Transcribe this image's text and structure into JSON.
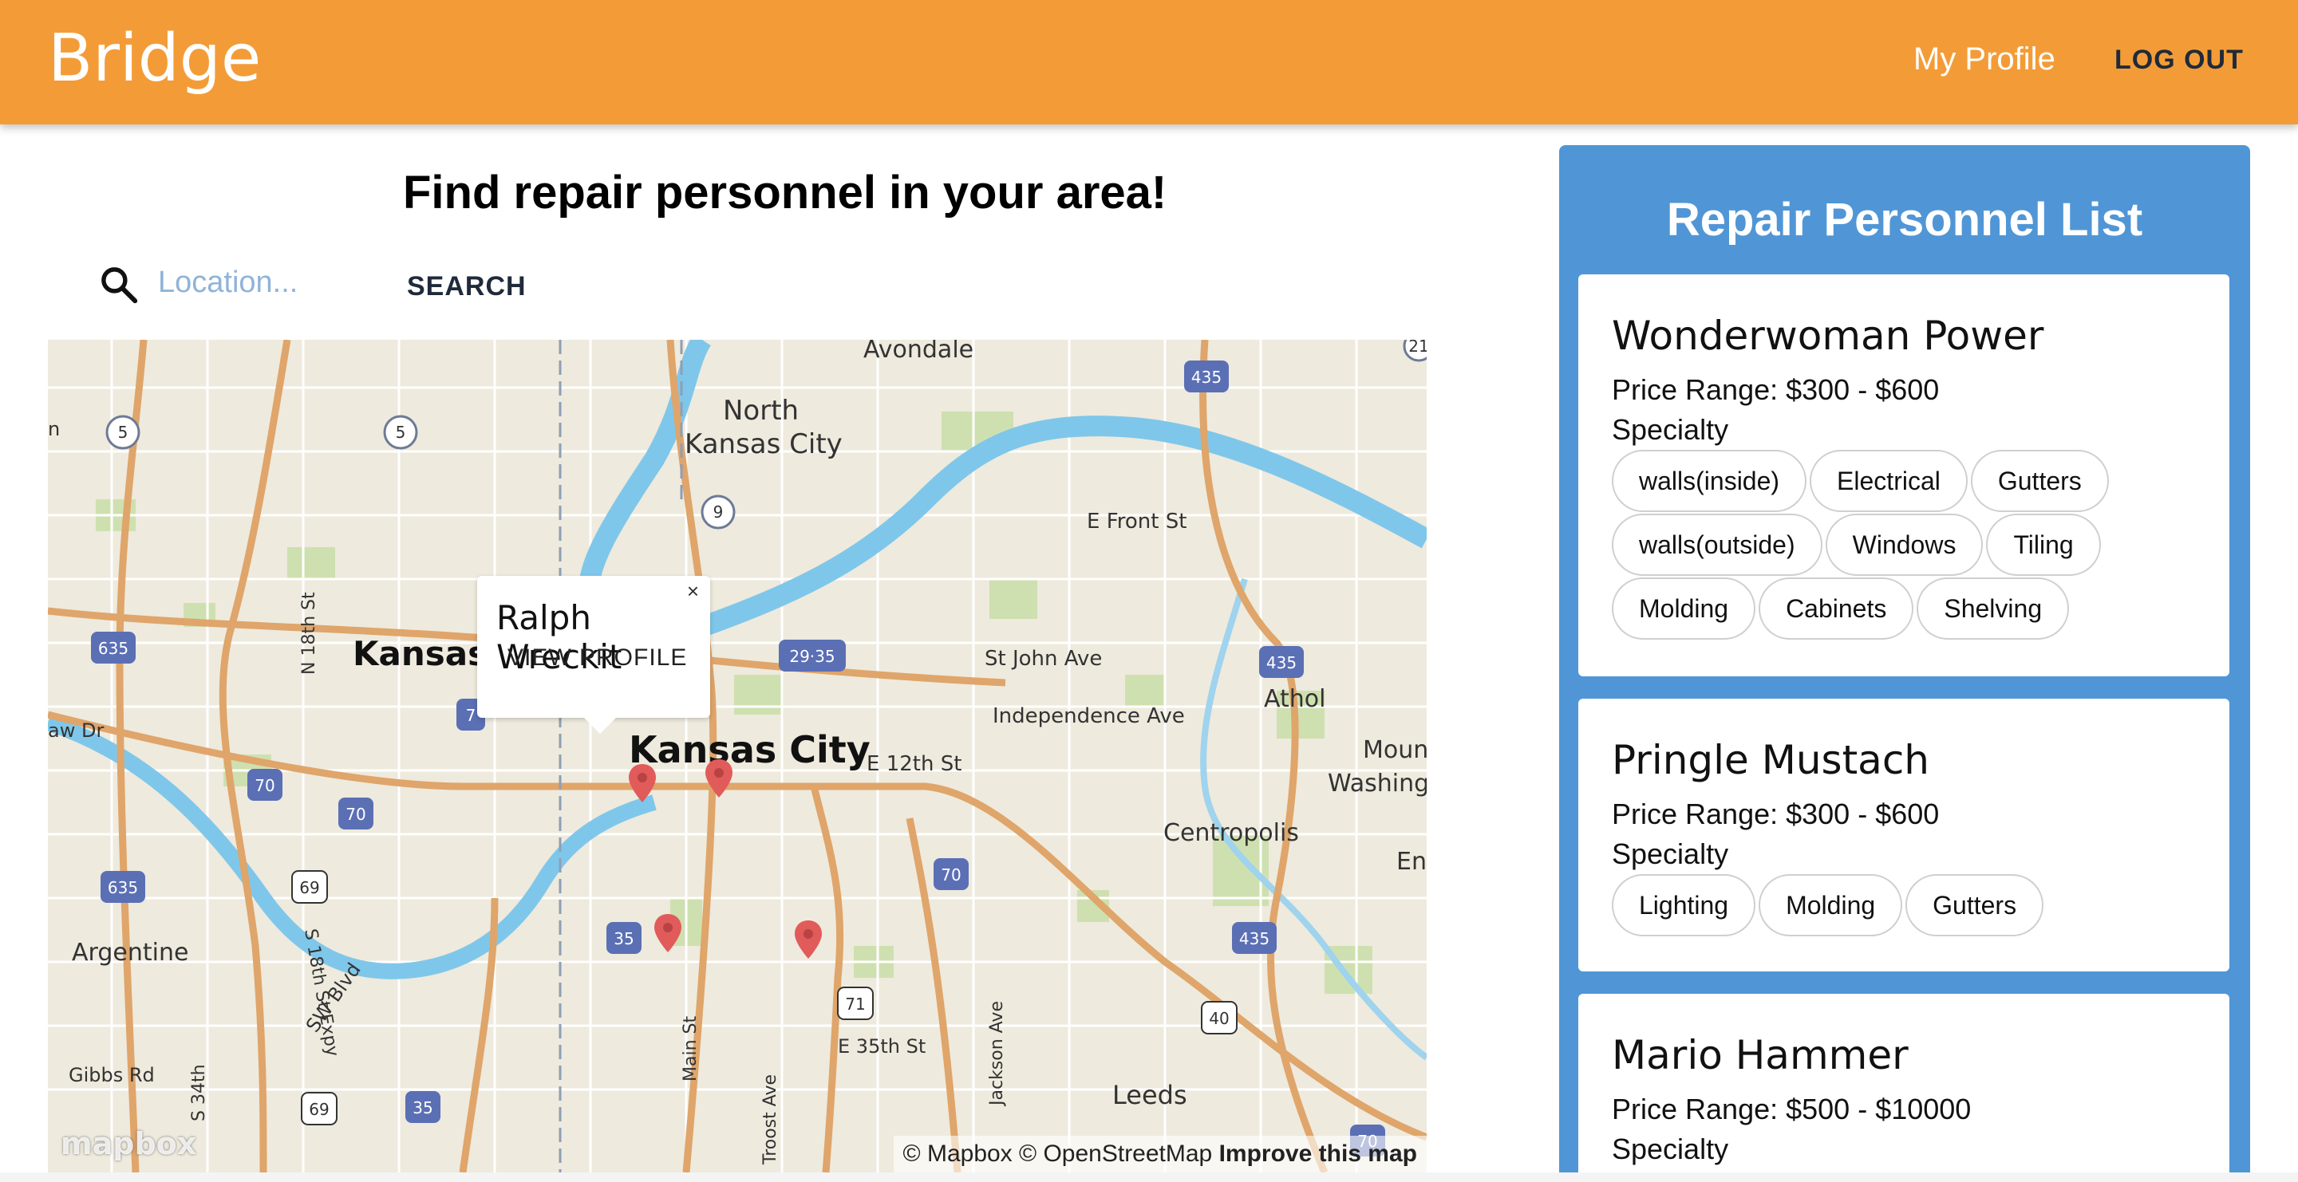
{
  "appbar": {
    "brand": "Bridge",
    "profile_link": "My Profile",
    "logout_label": "LOG OUT",
    "color": "#f39c37"
  },
  "search": {
    "heading": "Find repair personnel in your area!",
    "placeholder": "Location...",
    "button_label": "SEARCH",
    "icon": "search-icon"
  },
  "map": {
    "popup": {
      "name": "Ralph Wreckit",
      "view_label": "VIEW PROFILE",
      "close_glyph": "×"
    },
    "place_labels": {
      "avondale": "Avondale",
      "north_kc_1": "North",
      "north_kc_2": "Kansas City",
      "kansas": "Kansas",
      "kansas_city": "Kansas City",
      "e_front_st": "E Front St",
      "st_john_ave": "St John Ave",
      "independence_ave": "Independence Ave",
      "e_12th_st": "E 12th St",
      "athol": "Athol",
      "mount": "Mount",
      "washing": "Washing",
      "centropolis": "Centropolis",
      "en": "En",
      "argentine": "Argentine",
      "gibbs_rd": "Gibbs Rd",
      "sw_blvd": "SW Blvd",
      "main_st": "Main St",
      "troost_ave": "Troost Ave",
      "e_35th_st": "E 35th St",
      "jackson_ave": "Jackson Ave",
      "leeds": "Leeds",
      "n_18th_st": "N 18th St",
      "s_18th_st_expy": "S 18th St Expy",
      "s_34th": "S 34th",
      "aw_dr": "aw Dr",
      "n_edge": "n"
    },
    "shields": {
      "s5a": "5",
      "s5b": "5",
      "s9": "9",
      "s435a": "435",
      "s435b": "435",
      "s435c": "435",
      "s635a": "635",
      "s635b": "635",
      "s29_35": "29·35",
      "s70a": "70",
      "s70b": "70",
      "s70c": "70",
      "s70d": "70",
      "s69a": "69",
      "s69b": "69",
      "s35a": "35",
      "s35b": "35",
      "s71": "71",
      "s40": "40",
      "s7": "7",
      "s21": "21"
    },
    "logo": "mapbox",
    "attribution": {
      "copy": "© Mapbox © OpenStreetMap",
      "improve": "Improve this map"
    },
    "marker_color": "#e15b5b"
  },
  "list": {
    "title": "Repair Personnel List",
    "color": "#5096d6",
    "specialty_label": "Specialty",
    "cards": [
      {
        "name": "Wonderwoman Power",
        "price": "Price Range: $300 - $600",
        "chips": [
          "walls(inside)",
          "Electrical",
          "Gutters",
          "walls(outside)",
          "Windows",
          "Tiling",
          "Molding",
          "Cabinets",
          "Shelving"
        ]
      },
      {
        "name": "Pringle Mustach",
        "price": "Price Range: $300 - $600",
        "chips": [
          "Lighting",
          "Molding",
          "Gutters"
        ]
      },
      {
        "name": "Mario Hammer",
        "price": "Price Range: $500 - $10000",
        "chips": []
      }
    ]
  }
}
